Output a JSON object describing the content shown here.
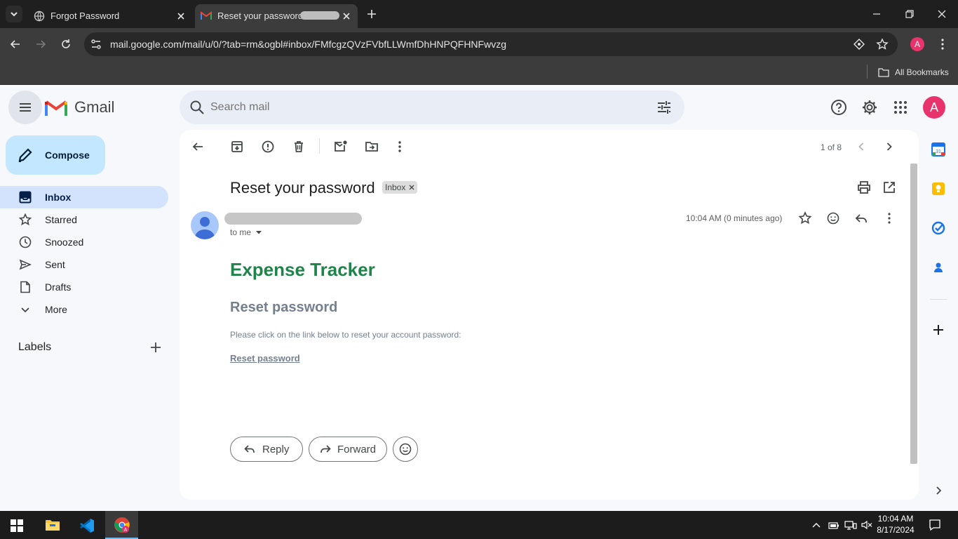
{
  "browser": {
    "tabs": [
      {
        "title": "Forgot Password"
      },
      {
        "title": "Reset your password -"
      }
    ],
    "url": "mail.google.com/mail/u/0/?tab=rm&ogbl#inbox/FMfcgzQVzFVbfLLWmfDhHNPQFHNFwvzg",
    "profile_initial": "A",
    "bookmarks_label": "All Bookmarks"
  },
  "gmail": {
    "brand": "Gmail",
    "search_placeholder": "Search mail",
    "compose_label": "Compose",
    "nav": [
      {
        "label": "Inbox"
      },
      {
        "label": "Starred"
      },
      {
        "label": "Snoozed"
      },
      {
        "label": "Sent"
      },
      {
        "label": "Drafts"
      },
      {
        "label": "More"
      }
    ],
    "labels_heading": "Labels",
    "avatar_initial": "A",
    "pager": "1 of 8",
    "email": {
      "subject": "Reset your password",
      "label_chip": "Inbox",
      "recipient": "to me",
      "timestamp": "10:04 AM (0 minutes ago)",
      "body": {
        "brand_title": "Expense Tracker",
        "heading": "Reset password",
        "instruction": "Please click on the link below to reset your account password:",
        "link_text": "Reset password"
      },
      "reply_label": "Reply",
      "forward_label": "Forward"
    }
  },
  "taskbar": {
    "time": "10:04 AM",
    "date": "8/17/2024"
  },
  "colors": {
    "brand_green": "#1e8449",
    "selected_nav": "#d3e3fd",
    "compose_bg": "#c2e7ff",
    "avatar": "#e8336d"
  }
}
